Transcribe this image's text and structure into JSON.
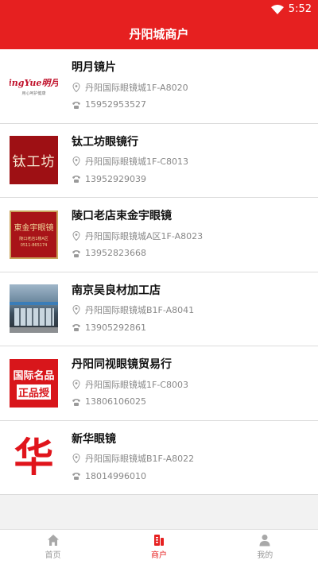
{
  "status": {
    "time": "5:52"
  },
  "header": {
    "title": "丹阳城商户"
  },
  "merchants": [
    {
      "name": "明月镜片",
      "address": "丹阳国际眼镜城1F-A8020",
      "phone": "15952953527",
      "logo_text": "ingYue明月",
      "logo_sub": "用心呵护健康"
    },
    {
      "name": "钛工坊眼镜行",
      "address": "丹阳国际眼镜城1F-C8013",
      "phone": "13952929039",
      "logo_text": "钛工坊"
    },
    {
      "name": "陵口老店束金宇眼镜",
      "address": "丹阳国际眼镜城A区1F-A8023",
      "phone": "13952823668",
      "logo_text": "東金宇眼镜",
      "logo_sub": "陵口老店1楼A区",
      "logo_sub2": "0511-865174"
    },
    {
      "name": "南京吴良材加工店",
      "address": "丹阳国际眼镜城B1F-A8041",
      "phone": "13905292861"
    },
    {
      "name": "丹阳同视眼镜贸易行",
      "address": "丹阳国际眼镜城1F-C8003",
      "phone": "13806106025",
      "logo_text": "国际名品",
      "logo_sub": "正品授"
    },
    {
      "name": "新华眼镜",
      "address": "丹阳国际眼镜城B1F-A8022",
      "phone": "18014996010",
      "logo_text": "华"
    }
  ],
  "tabs": [
    {
      "label": "首页",
      "icon": "home-icon"
    },
    {
      "label": "商户",
      "icon": "store-icon",
      "active": true
    },
    {
      "label": "我的",
      "icon": "user-icon"
    }
  ],
  "colors": {
    "primary": "#e62020",
    "text": "#111111",
    "muted": "#888888"
  }
}
